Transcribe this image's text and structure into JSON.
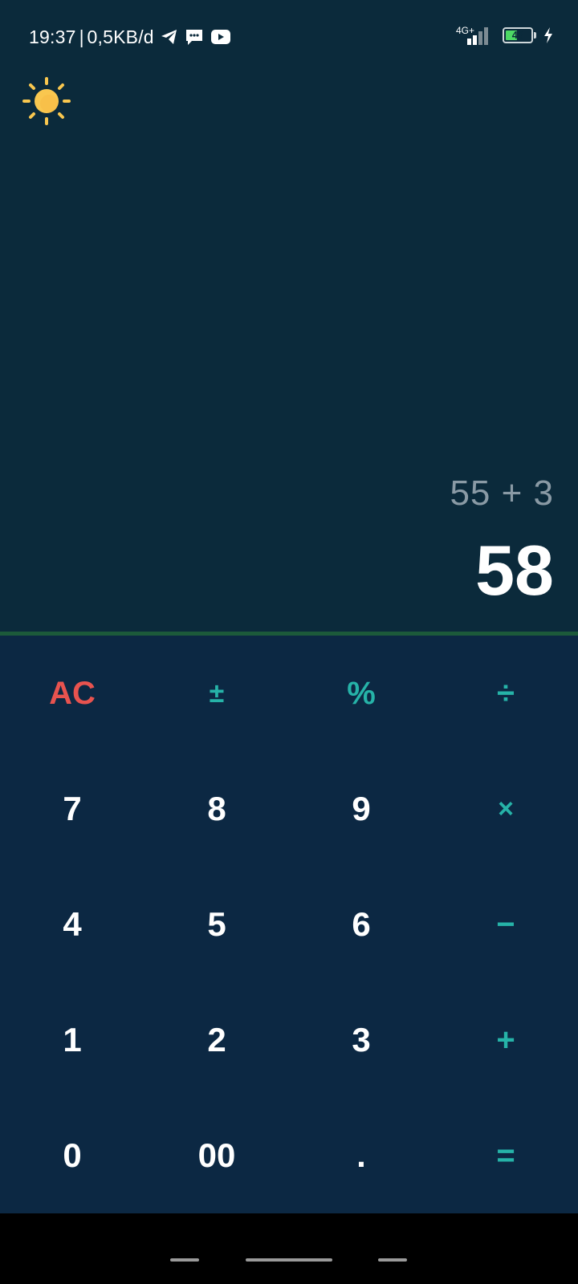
{
  "status_bar": {
    "time": "19:37",
    "separator": "|",
    "data_rate": "0,5KB/d",
    "network_type": "4G+",
    "battery_level": "48",
    "battery_fraction": 0.48,
    "icons": [
      "telegram-icon",
      "message-icon",
      "youtube-icon",
      "signal-icon",
      "battery-icon",
      "charging-icon"
    ]
  },
  "theme_toggle": {
    "icon": "sun-icon"
  },
  "display": {
    "expression": "55 + 3",
    "result": "58"
  },
  "keypad": {
    "rows": [
      [
        {
          "label": "AC",
          "name": "all-clear-button",
          "kind": "clear"
        },
        {
          "label": "±",
          "name": "plus-minus-button",
          "kind": "op"
        },
        {
          "label": "%",
          "name": "percent-button",
          "kind": "op"
        },
        {
          "label": "÷",
          "name": "divide-button",
          "kind": "op"
        }
      ],
      [
        {
          "label": "7",
          "name": "digit-7-button",
          "kind": "digit"
        },
        {
          "label": "8",
          "name": "digit-8-button",
          "kind": "digit"
        },
        {
          "label": "9",
          "name": "digit-9-button",
          "kind": "digit"
        },
        {
          "label": "×",
          "name": "multiply-button",
          "kind": "op"
        }
      ],
      [
        {
          "label": "4",
          "name": "digit-4-button",
          "kind": "digit"
        },
        {
          "label": "5",
          "name": "digit-5-button",
          "kind": "digit"
        },
        {
          "label": "6",
          "name": "digit-6-button",
          "kind": "digit"
        },
        {
          "label": "−",
          "name": "subtract-button",
          "kind": "op"
        }
      ],
      [
        {
          "label": "1",
          "name": "digit-1-button",
          "kind": "digit"
        },
        {
          "label": "2",
          "name": "digit-2-button",
          "kind": "digit"
        },
        {
          "label": "3",
          "name": "digit-3-button",
          "kind": "digit"
        },
        {
          "label": "+",
          "name": "add-button",
          "kind": "op"
        }
      ],
      [
        {
          "label": "0",
          "name": "digit-0-button",
          "kind": "digit"
        },
        {
          "label": "00",
          "name": "double-zero-button",
          "kind": "digit"
        },
        {
          "label": ".",
          "name": "decimal-button",
          "kind": "digit"
        },
        {
          "label": "=",
          "name": "equals-button",
          "kind": "op"
        }
      ]
    ]
  },
  "colors": {
    "background": "#0b2a3b",
    "keypad_background": "#0c2843",
    "accent_teal": "#26b3a8",
    "clear_red": "#e8534f",
    "divider_green": "#1c5a3a",
    "sun_yellow": "#f9c74f"
  }
}
